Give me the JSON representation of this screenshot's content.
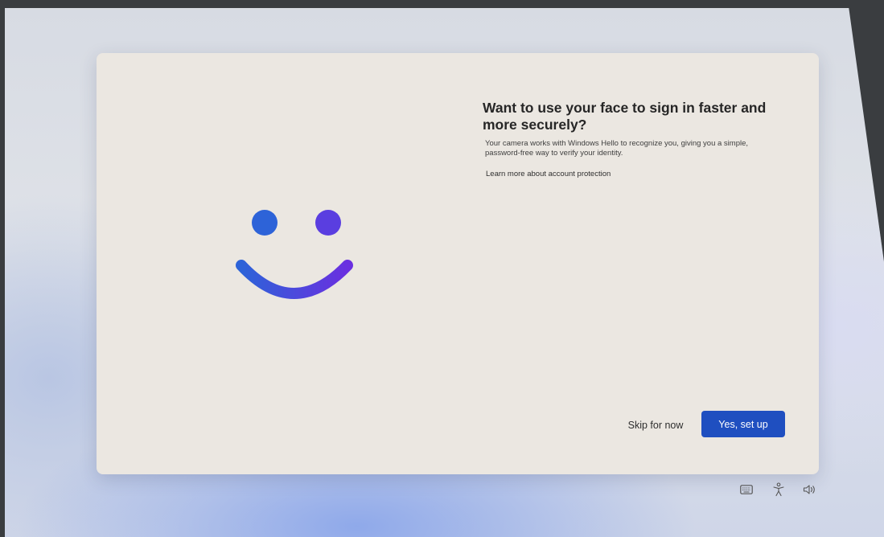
{
  "oobe": {
    "title": "Want to use your face to sign in faster and more securely?",
    "description": "Your camera works with Windows Hello to recognize you, giving you a simple, password-free way to verify your identity.",
    "learn_more_link": "Learn more about account protection",
    "skip_label": "Skip for now",
    "confirm_label": "Yes, set up"
  },
  "graphic": {
    "icon": "windows-hello-smiley-icon",
    "gradient_start": "#2d63d8",
    "gradient_end": "#6a2fe0"
  },
  "tray": {
    "icons": [
      "keyboard-icon",
      "accessibility-icon",
      "volume-icon"
    ]
  },
  "colors": {
    "accent": "#1f4fc0",
    "dialog_bg": "#ebe7e1"
  }
}
